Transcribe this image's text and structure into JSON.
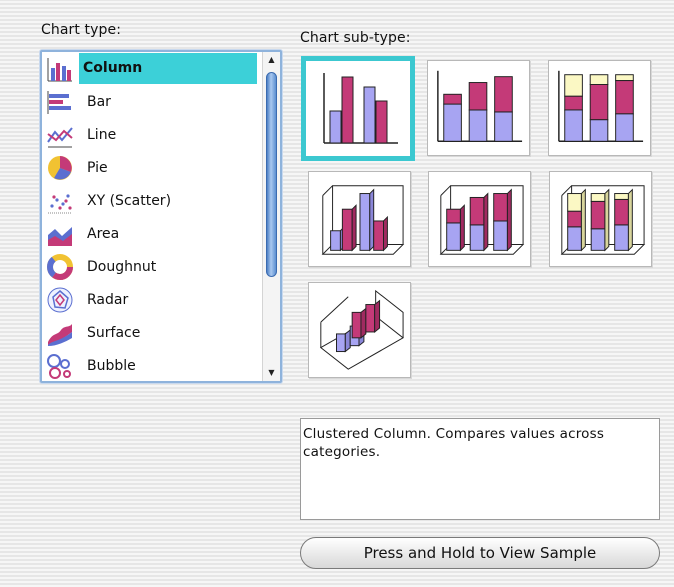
{
  "chart_type_label": "Chart type:",
  "chart_subtype_label": "Chart sub-type:",
  "chart_types": [
    {
      "label": "Column",
      "icon": "column-chart-icon",
      "selected": true
    },
    {
      "label": "Bar",
      "icon": "bar-chart-icon"
    },
    {
      "label": "Line",
      "icon": "line-chart-icon"
    },
    {
      "label": "Pie",
      "icon": "pie-chart-icon"
    },
    {
      "label": "XY (Scatter)",
      "icon": "scatter-chart-icon"
    },
    {
      "label": "Area",
      "icon": "area-chart-icon"
    },
    {
      "label": "Doughnut",
      "icon": "doughnut-chart-icon"
    },
    {
      "label": "Radar",
      "icon": "radar-chart-icon"
    },
    {
      "label": "Surface",
      "icon": "surface-chart-icon"
    },
    {
      "label": "Bubble",
      "icon": "bubble-chart-icon"
    }
  ],
  "subtypes": [
    {
      "icon": "clustered-column-icon",
      "selected": true
    },
    {
      "icon": "stacked-column-icon"
    },
    {
      "icon": "100-percent-stacked-column-icon"
    },
    {
      "icon": "3d-clustered-column-icon"
    },
    {
      "icon": "3d-stacked-column-icon"
    },
    {
      "icon": "3d-100-percent-stacked-column-icon"
    },
    {
      "icon": "3d-column-icon"
    }
  ],
  "description": "Clustered Column. Compares values across categories.",
  "view_sample_button": "Press and Hold to View Sample",
  "colors": {
    "selection": "#3cd0d8",
    "series_1": "#a7a4f2",
    "series_2": "#c43a78",
    "series_3": "#fbf8c4"
  }
}
